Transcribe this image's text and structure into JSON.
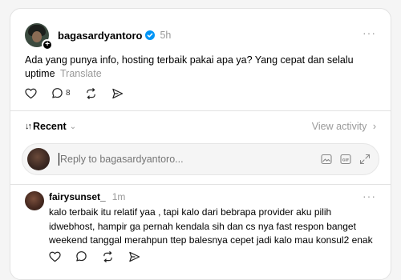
{
  "post": {
    "username": "bagasardyantoro",
    "time": "5h",
    "text": "Ada yang punya info, hosting terbaik pakai apa ya? Yang cepat dan selalu uptime",
    "translate": "Translate",
    "reply_count": "8",
    "more": "···"
  },
  "sort": {
    "arrow": "↓↑",
    "label": "Recent",
    "view_activity": "View activity"
  },
  "reply_box": {
    "placeholder": "Reply to bagasardyantoro..."
  },
  "comment": {
    "username": "fairysunset_",
    "time": "1m",
    "text": "kalo terbaik itu relatif yaa , tapi kalo dari bebrapa provider aku pilih idwebhost, hampir ga pernah kendala sih dan cs nya fast respon banget weekend tanggal merahpun ttep balesnya cepet jadi kalo mau konsul2 enak",
    "more": "···"
  },
  "colors": {
    "verified": "#0095f6",
    "muted": "#999999",
    "border": "#e2e2e2"
  },
  "icons": [
    "heart-icon",
    "comment-icon",
    "repost-icon",
    "share-icon",
    "verified-icon",
    "image-icon",
    "gif-icon",
    "expand-icon",
    "chevron-right-icon"
  ]
}
